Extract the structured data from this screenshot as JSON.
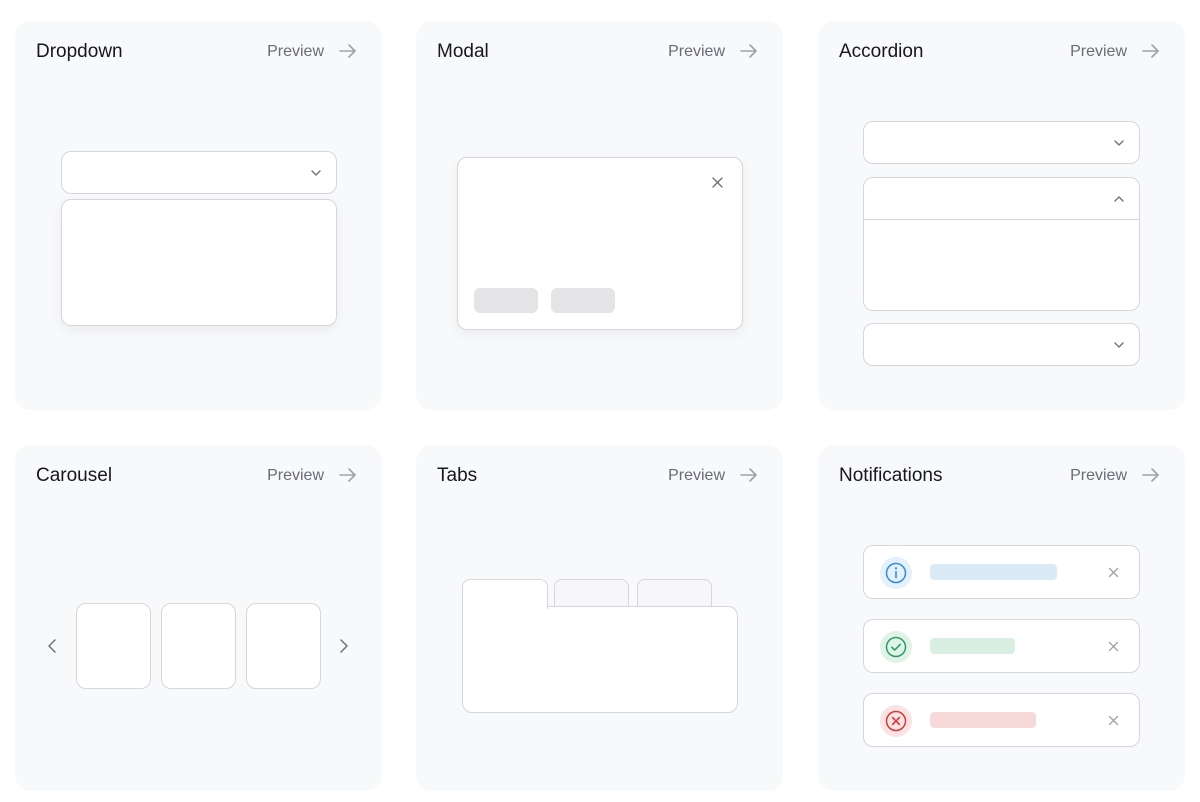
{
  "cards": [
    {
      "title": "Dropdown",
      "preview": "Preview"
    },
    {
      "title": "Modal",
      "preview": "Preview"
    },
    {
      "title": "Accordion",
      "preview": "Preview"
    },
    {
      "title": "Carousel",
      "preview": "Preview"
    },
    {
      "title": "Tabs",
      "preview": "Preview"
    },
    {
      "title": "Notifications",
      "preview": "Preview"
    }
  ],
  "colors": {
    "card_bg": "#f8f9fb",
    "border": "#d6d6dc",
    "info": "#2f8fd0",
    "info_bar": "#dbeaf7",
    "success": "#2e9e64",
    "success_bar": "#d9efe2",
    "error": "#d23a3a",
    "error_bar": "#f7d9da",
    "button_placeholder": "#e4e4e7"
  },
  "icons": {
    "preview_arrow": "arrow-right-icon",
    "dropdown": "chevron-down-icon",
    "modal_close": "close-icon",
    "accordion_open": "chevron-up-icon",
    "carousel_prev": "chevron-left-icon",
    "carousel_next": "chevron-right-icon",
    "notification_info": "info-icon",
    "notification_success": "check-circle-icon",
    "notification_error": "x-circle-icon"
  }
}
